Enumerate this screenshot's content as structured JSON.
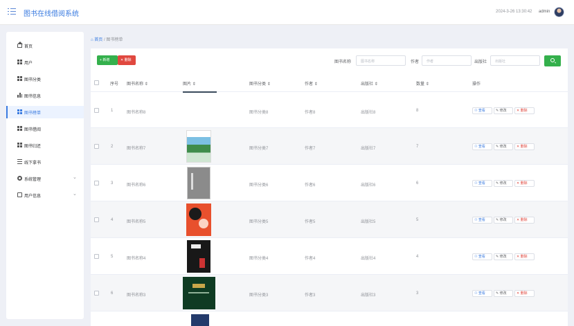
{
  "header": {
    "title": "图书在线借阅系统",
    "datetime": "2024-3-26 13:30:42",
    "username": "admin"
  },
  "sidebar": {
    "items": [
      {
        "label": "首页",
        "icon": "home-icon"
      },
      {
        "label": "用户",
        "icon": "grid-icon"
      },
      {
        "label": "图书分类",
        "icon": "grid-icon"
      },
      {
        "label": "图书信息",
        "icon": "bar-chart-icon"
      },
      {
        "label": "图书榜单",
        "icon": "grid-icon",
        "active": true
      },
      {
        "label": "图书借阅",
        "icon": "grid-icon"
      },
      {
        "label": "图书归还",
        "icon": "grid-icon"
      },
      {
        "label": "线下拿书",
        "icon": "list-icon"
      },
      {
        "label": "系统管理",
        "icon": "gear-icon",
        "expandable": true
      },
      {
        "label": "用户信息",
        "icon": "card-icon",
        "expandable": true
      }
    ]
  },
  "breadcrumb": {
    "home": "首页",
    "separator": "/",
    "current": "图书榜单"
  },
  "toolbar": {
    "add_label": "新增",
    "delete_label": "删除",
    "filters": [
      {
        "label": "图书名称",
        "placeholder": "图书名称"
      },
      {
        "label": "作者",
        "placeholder": "作者"
      },
      {
        "label": "出版社",
        "placeholder": "出版社"
      }
    ]
  },
  "table": {
    "headers": {
      "index": "序号",
      "name": "图书名称",
      "image": "图片",
      "category": "图书分类",
      "author": "作者",
      "publisher": "出版社",
      "quantity": "数量",
      "actions": "操作"
    },
    "action_labels": {
      "view": "查看",
      "edit": "修改",
      "delete": "删除"
    },
    "rows": [
      {
        "index": "1",
        "name": "图书名称8",
        "category": "图书分类8",
        "author": "作者8",
        "publisher": "出版社8",
        "quantity": "8",
        "cover": "none"
      },
      {
        "index": "2",
        "name": "图书名称7",
        "category": "图书分类7",
        "author": "作者7",
        "publisher": "出版社7",
        "quantity": "7",
        "cover": "landscape"
      },
      {
        "index": "3",
        "name": "图书名称6",
        "category": "图书分类6",
        "author": "作者6",
        "publisher": "出版社6",
        "quantity": "6",
        "cover": "gray"
      },
      {
        "index": "4",
        "name": "图书名称5",
        "category": "图书分类5",
        "author": "作者5",
        "publisher": "出版社5",
        "quantity": "5",
        "cover": "orange"
      },
      {
        "index": "5",
        "name": "图书名称4",
        "category": "图书分类4",
        "author": "作者4",
        "publisher": "出版社4",
        "quantity": "4",
        "cover": "dark"
      },
      {
        "index": "6",
        "name": "图书名称3",
        "category": "图书分类3",
        "author": "作者3",
        "publisher": "出版社3",
        "quantity": "3",
        "cover": "green"
      }
    ]
  },
  "colors": {
    "accent": "#3a7be0",
    "success": "#34b04c",
    "danger": "#e0483f"
  }
}
